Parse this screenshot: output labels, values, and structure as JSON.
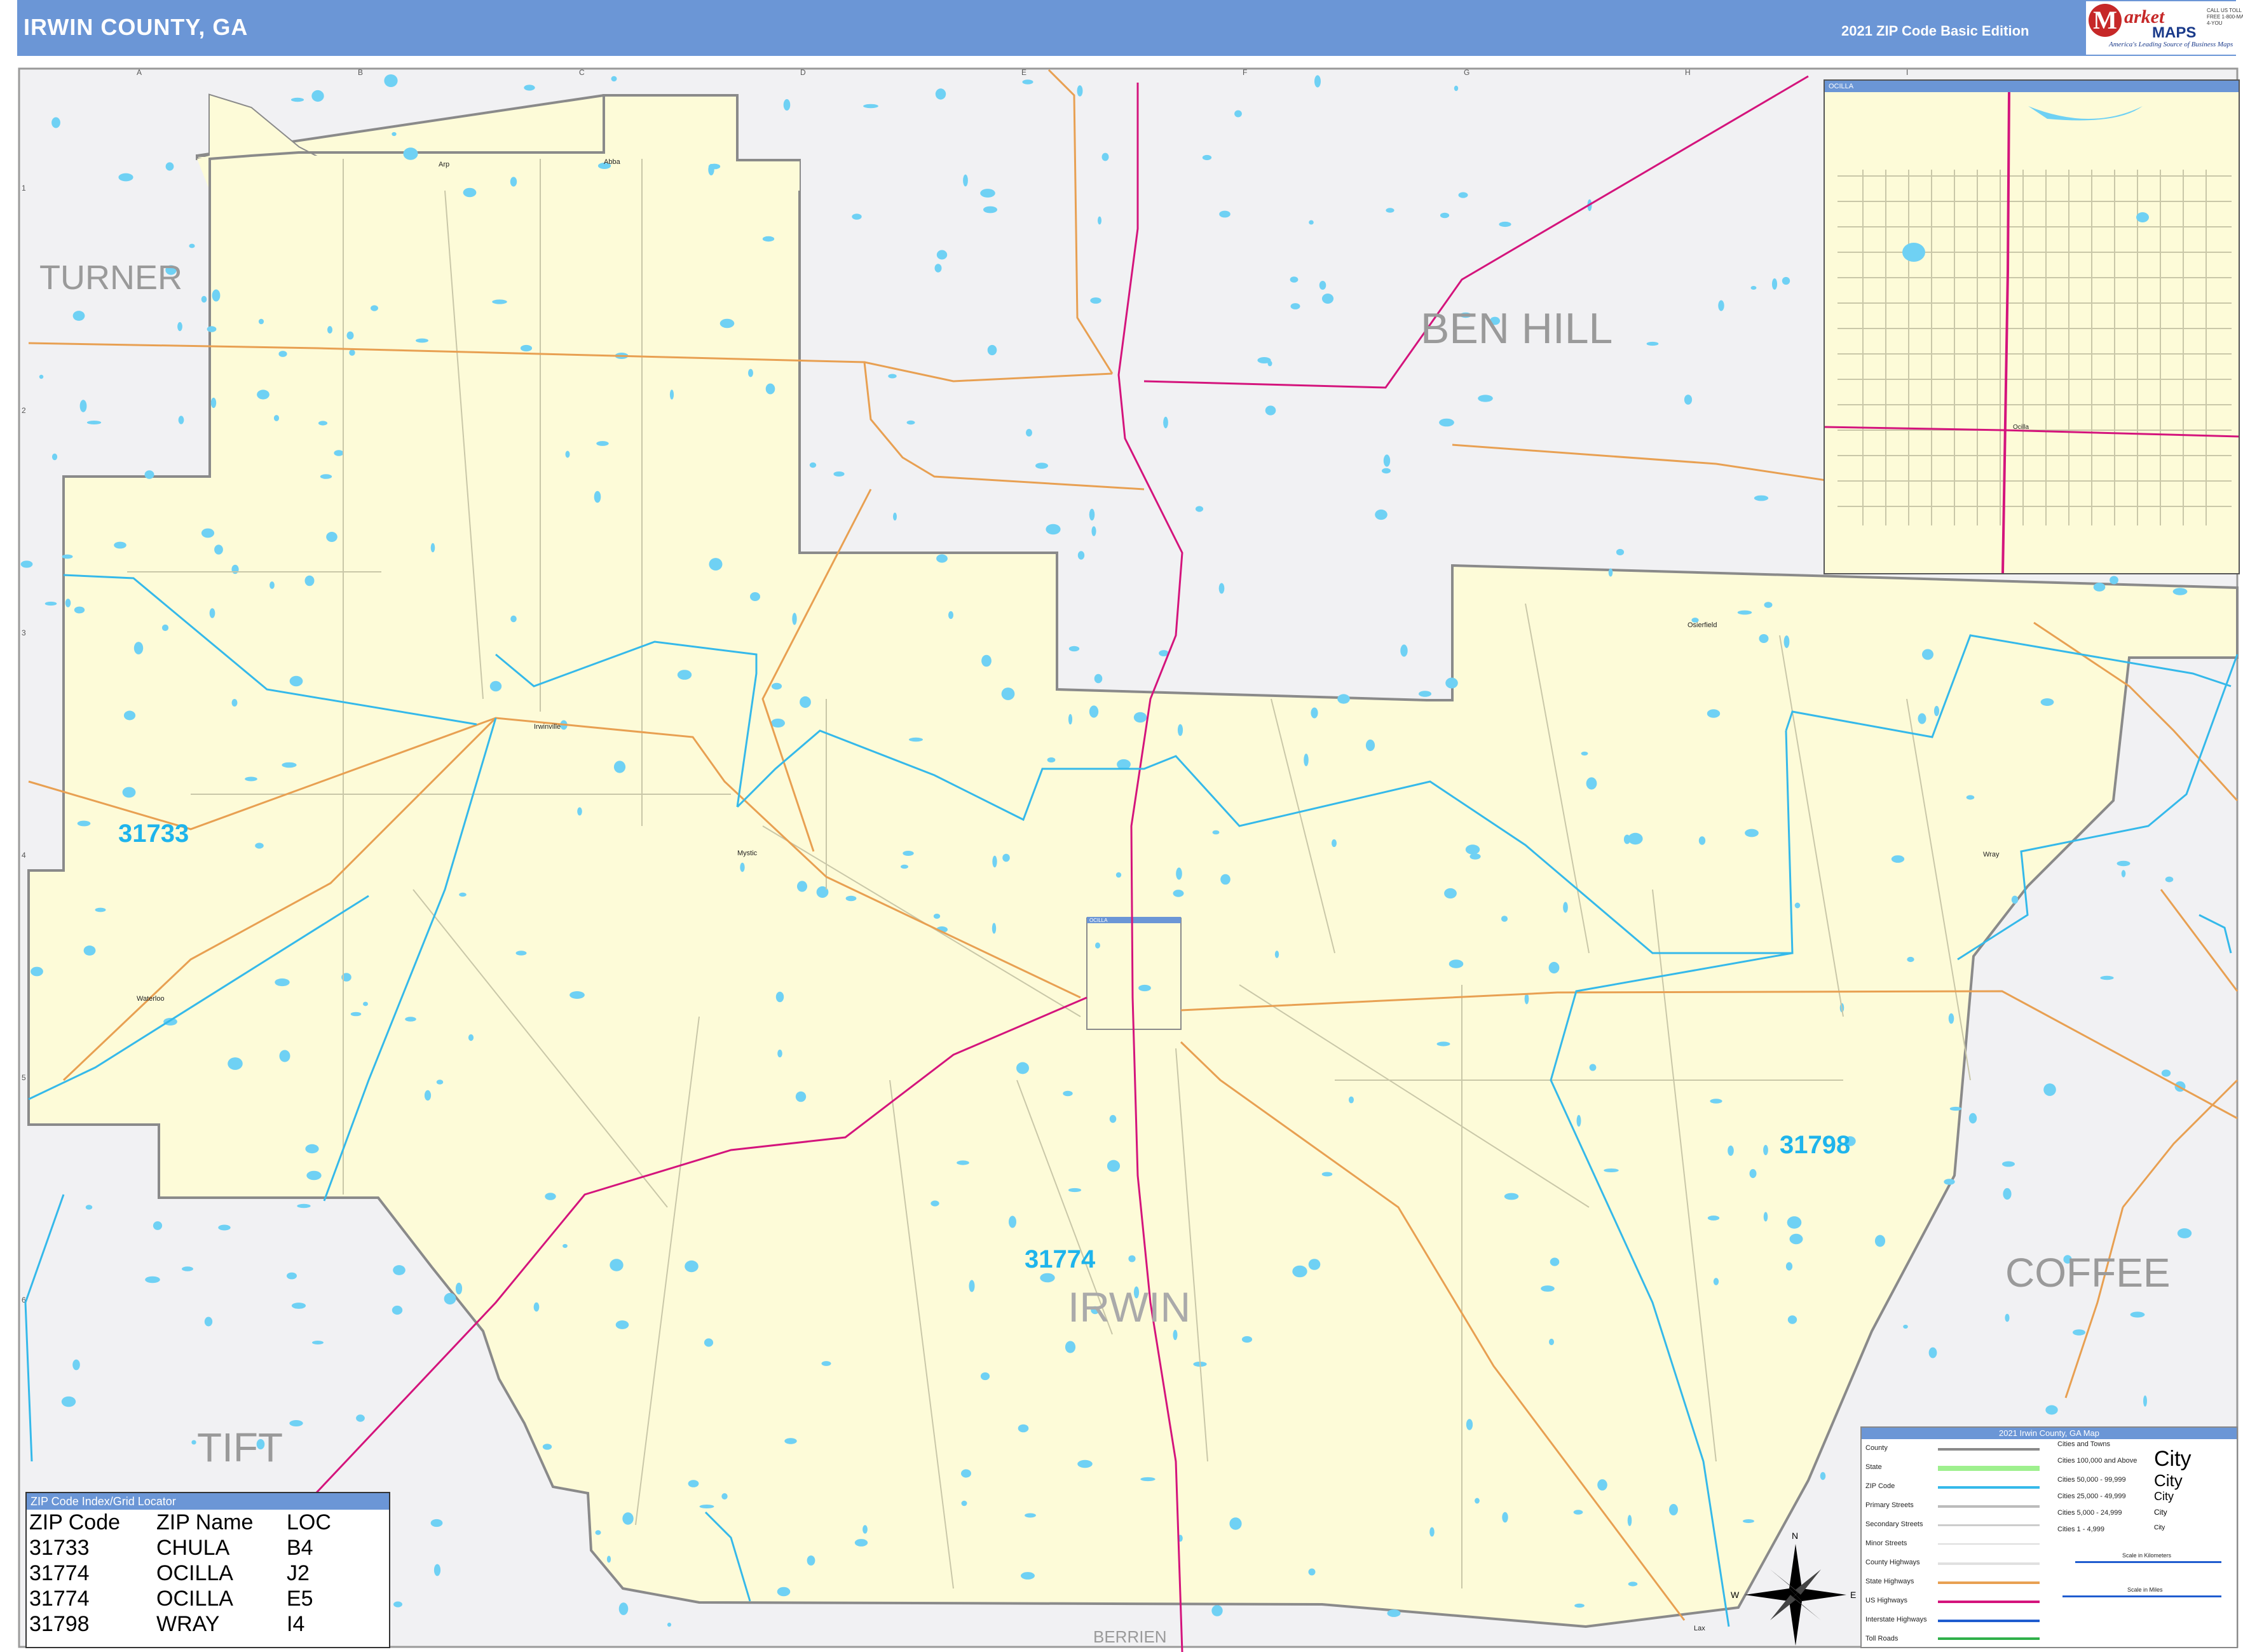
{
  "header": {
    "title": "IRWIN COUNTY, GA",
    "edition": "2021 ZIP Code Basic Edition"
  },
  "logo": {
    "brand_m": "M",
    "brand_top": "arket",
    "brand_bottom": "MAPS",
    "tagline": "America's Leading Source of Business Maps",
    "contact": "CALL US TOLL FREE 1-800-MAP-4-YOU"
  },
  "counties": {
    "turner": "TURNER",
    "ben_hill": "BEN HILL",
    "coffee": "COFFEE",
    "tift": "TIFT",
    "berrien": "BERRIEN",
    "irwin": "IRWIN"
  },
  "zip_labels": {
    "z31733": "31733",
    "z31774": "31774",
    "z31798": "31798"
  },
  "places": {
    "abba": "Abba",
    "arp": "Arp",
    "irwinville": "Irwinville",
    "mystic": "Mystic",
    "waterloo": "Waterloo",
    "osierfield": "Osierfield",
    "wray": "Wray",
    "lax": "Lax",
    "ocilla": "Ocilla",
    "inset_ocilla": "Ocilla"
  },
  "grid": {
    "cols": [
      "A",
      "B",
      "C",
      "D",
      "E",
      "F",
      "G",
      "H",
      "I"
    ],
    "rows": [
      "1",
      "2",
      "3",
      "4",
      "5",
      "6"
    ]
  },
  "inset": {
    "title": "OCILLA"
  },
  "ocilla_box_label": "OCILLA",
  "zip_index": {
    "title": "ZIP Code Index/Grid Locator",
    "headers": [
      "ZIP Code",
      "ZIP Name",
      "LOC"
    ],
    "rows": [
      [
        "31733",
        "CHULA",
        "B4"
      ],
      [
        "31774",
        "OCILLA",
        "J2"
      ],
      [
        "31774",
        "OCILLA",
        "E5"
      ],
      [
        "31798",
        "WRAY",
        "I4"
      ]
    ]
  },
  "legend": {
    "title": "2021 Irwin County, GA Map",
    "items": [
      "County",
      "State",
      "ZIP Code",
      "Primary Streets",
      "Secondary Streets",
      "Minor Streets",
      "County Highways",
      "State Highways",
      "US Highways",
      "Interstate Highways",
      "Toll Roads"
    ],
    "cities_title": "Cities and Towns",
    "cities": [
      "Cities 100,000 and Above",
      "Cities 50,000 - 99,999",
      "Cities 25,000 - 49,999",
      "Cities 5,000 - 24,999",
      "Cities 1 - 4,999"
    ],
    "city_word": "City",
    "scale_km": "Scale in Kilometers",
    "scale_mi": "Scale in Miles"
  },
  "compass": {
    "n": "N",
    "s": "S",
    "e": "E",
    "w": "W"
  },
  "colors": {
    "county_fill": "#fdfbd8",
    "outside_fill": "#f1f1f3",
    "water": "#6fd1f4",
    "zip_line": "#35b9ea",
    "us_highway": "#d4147c",
    "state_highway": "#e8a052",
    "county_border": "#8a8a8a",
    "header": "#6b96d6"
  }
}
